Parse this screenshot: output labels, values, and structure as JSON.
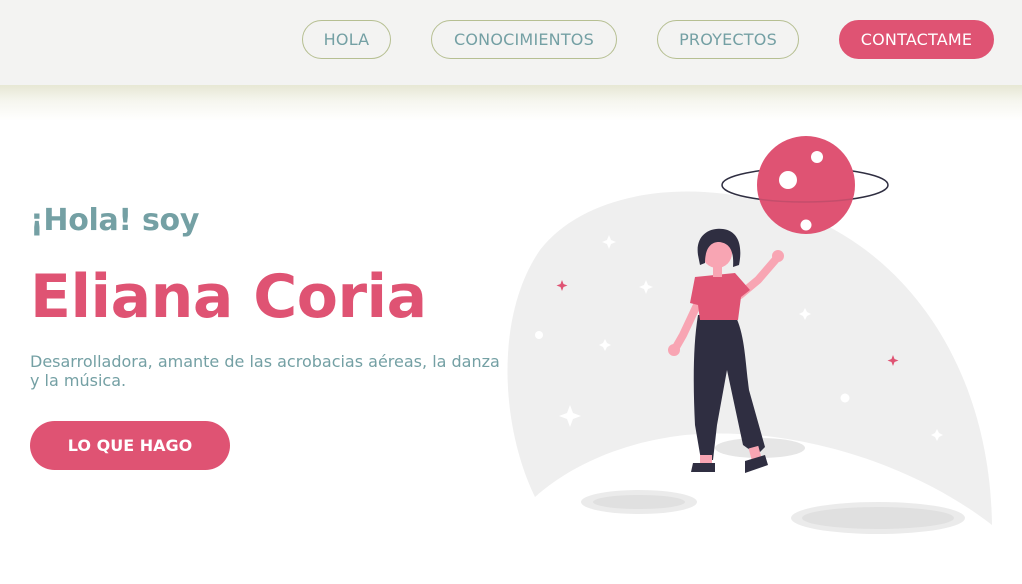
{
  "nav": {
    "items": [
      {
        "label": "HOLA"
      },
      {
        "label": "CONOCIMIENTOS"
      },
      {
        "label": "PROYECTOS"
      }
    ],
    "contact_label": "CONTACTAME"
  },
  "hero": {
    "greeting": "¡Hola! soy",
    "name": "Eliana Coria",
    "description": "Desarrolladora, amante de las acrobacias aéreas, la danza y la música.",
    "cta_label": "LO QUE HAGO"
  },
  "colors": {
    "accent": "#df5373",
    "teal": "#74a0a4",
    "nav_border": "#b6bf92",
    "dark": "#2f2e41"
  }
}
